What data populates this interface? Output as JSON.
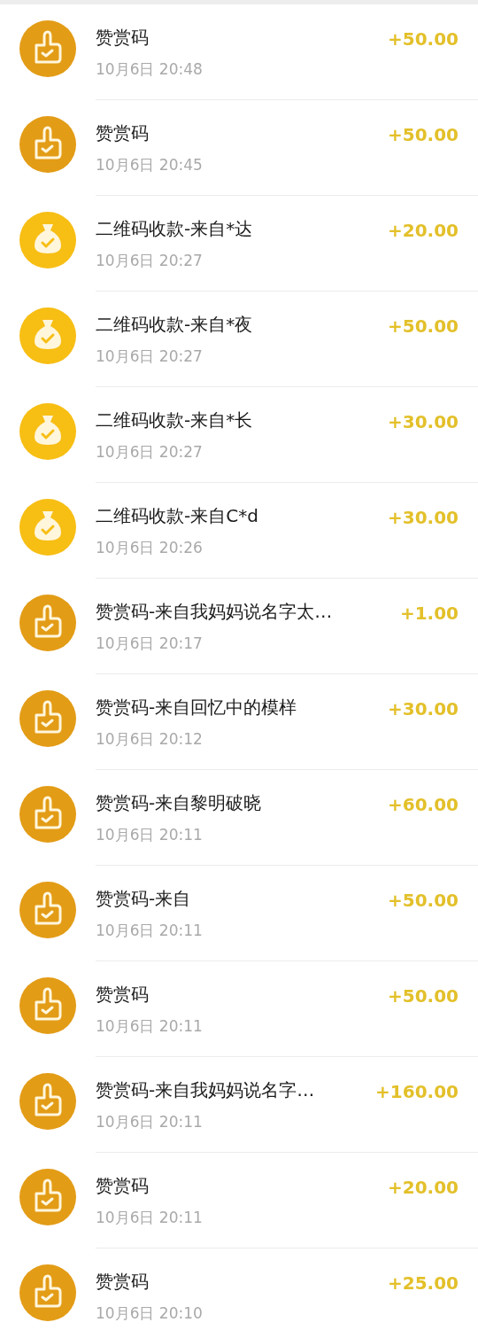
{
  "transactions": [
    {
      "kind": "thumb",
      "title": "赞赏码",
      "time": "10月6日 20:48",
      "amount": "+50.00"
    },
    {
      "kind": "thumb",
      "title": "赞赏码",
      "time": "10月6日 20:45",
      "amount": "+50.00"
    },
    {
      "kind": "bag",
      "title": "二维码收款-来自*达",
      "time": "10月6日 20:27",
      "amount": "+20.00"
    },
    {
      "kind": "bag",
      "title": "二维码收款-来自*夜",
      "time": "10月6日 20:27",
      "amount": "+50.00"
    },
    {
      "kind": "bag",
      "title": "二维码收款-来自*长",
      "time": "10月6日 20:27",
      "amount": "+30.00"
    },
    {
      "kind": "bag",
      "title": "二维码收款-来自C*d",
      "time": "10月6日 20:26",
      "amount": "+30.00"
    },
    {
      "kind": "thumb",
      "title": "赞赏码-来自我妈妈说名字太…",
      "time": "10月6日 20:17",
      "amount": "+1.00"
    },
    {
      "kind": "thumb",
      "title": "赞赏码-来自回忆中的模样",
      "time": "10月6日 20:12",
      "amount": "+30.00"
    },
    {
      "kind": "thumb",
      "title": "赞赏码-来自黎明破晓",
      "time": "10月6日 20:11",
      "amount": "+60.00"
    },
    {
      "kind": "thumb",
      "title": "赞赏码-来自",
      "time": "10月6日 20:11",
      "amount": "+50.00"
    },
    {
      "kind": "thumb",
      "title": "赞赏码",
      "time": "10月6日 20:11",
      "amount": "+50.00"
    },
    {
      "kind": "thumb",
      "title": "赞赏码-来自我妈妈说名字…",
      "time": "10月6日 20:11",
      "amount": "+160.00"
    },
    {
      "kind": "thumb",
      "title": "赞赏码",
      "time": "10月6日 20:11",
      "amount": "+20.00"
    },
    {
      "kind": "thumb",
      "title": "赞赏码",
      "time": "10月6日 20:10",
      "amount": "+25.00"
    }
  ]
}
